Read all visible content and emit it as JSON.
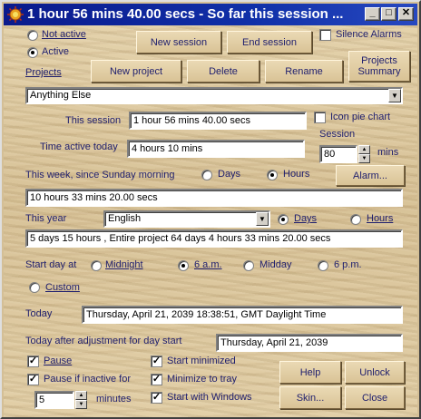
{
  "window": {
    "title": "1 hour 56 mins 40.00 secs - So far this session ...",
    "minimize": "_",
    "restore": "□",
    "close": "✕"
  },
  "mode": {
    "not_active": "Not active",
    "active": "Active",
    "selected": "active"
  },
  "buttons": {
    "new_session": "New session",
    "end_session": "End session",
    "new_project": "New project",
    "delete": "Delete",
    "rename": "Rename",
    "projects_summary_1": "Projects",
    "projects_summary_2": "Summary",
    "alarm": "Alarm...",
    "help": "Help",
    "unlock": "Unlock",
    "skin": "Skin...",
    "close": "Close"
  },
  "silence_alarms": {
    "label": "Silence Alarms",
    "checked": false
  },
  "projects": {
    "label": "Projects",
    "selected": "Anything Else"
  },
  "this_session": {
    "label": "This session",
    "value": "1 hour 56 mins 40.00 secs"
  },
  "icon_pie_chart": {
    "label": "Icon pie chart",
    "checked": false
  },
  "time_active_today": {
    "label": "Time active today",
    "value": "4 hours 10 mins"
  },
  "session_length": {
    "label": "Session",
    "value": "80",
    "unit": "mins"
  },
  "this_week": {
    "label": "This week, since Sunday morning",
    "days": "Days",
    "hours": "Hours",
    "selected": "hours",
    "value": "10 hours 33 mins 20.00 secs"
  },
  "this_year": {
    "label": "This year",
    "language": "English",
    "days": "Days",
    "hours": "Hours",
    "selected": "days",
    "value": "5 days 15 hours , Entire project 64 days 4 hours 33 mins 20.00 secs"
  },
  "start_day": {
    "label": "Start day at",
    "midnight": "Midnight",
    "six_am": "6 a.m.",
    "midday": "Midday",
    "six_pm": "6 p.m.",
    "custom": "Custom",
    "selected": "six_am"
  },
  "today": {
    "label": "Today",
    "value": "Thursday, April 21, 2039 18:38:51, GMT Daylight Time"
  },
  "today_adjusted": {
    "label": "Today after adjustment for day start",
    "value": "Thursday, April 21, 2039"
  },
  "options": {
    "pause": "Pause",
    "pause_if_inactive": "Pause if inactive for",
    "inactive_minutes": "5",
    "minutes": "minutes",
    "start_minimized": "Start minimized",
    "minimize_to_tray": "Minimize to tray",
    "start_with_windows": "Start with Windows"
  }
}
